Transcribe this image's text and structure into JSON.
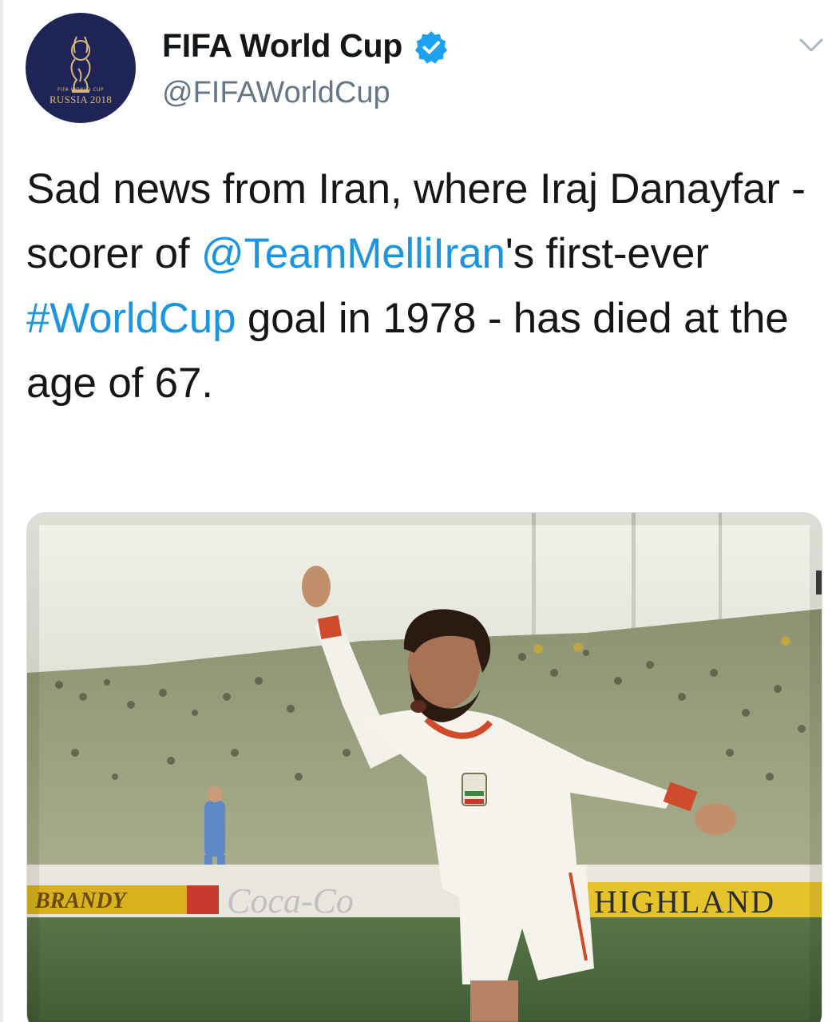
{
  "author": {
    "name": "FIFA World Cup",
    "handle": "@FIFAWorldCup",
    "verified": true,
    "avatar": {
      "line1": "FIFA WORLD CUP",
      "line2": "RUSSIA 2018",
      "background": "#1f2457",
      "accent": "#d9b77a"
    }
  },
  "menu": {
    "icon": "chevron-down-icon"
  },
  "tweet": {
    "segments": [
      {
        "text": "Sad news from Iran, where Iraj Danayfar - scorer of ",
        "type": "text"
      },
      {
        "text": "@TeamMelliIran",
        "type": "mention"
      },
      {
        "text": "'s first-ever ",
        "type": "text"
      },
      {
        "text": "#WorldCup",
        "type": "hashtag"
      },
      {
        "text": " goal in 1978 - has died at the age of 67.",
        "type": "text"
      }
    ]
  },
  "media": {
    "kind": "photo",
    "boards": [
      "BRANDY",
      "Coca-Co",
      "HIGHLAND"
    ]
  },
  "colors": {
    "link": "#1b95e0",
    "text": "#14171a",
    "secondary": "#657786",
    "verified": "#1da1f2"
  }
}
